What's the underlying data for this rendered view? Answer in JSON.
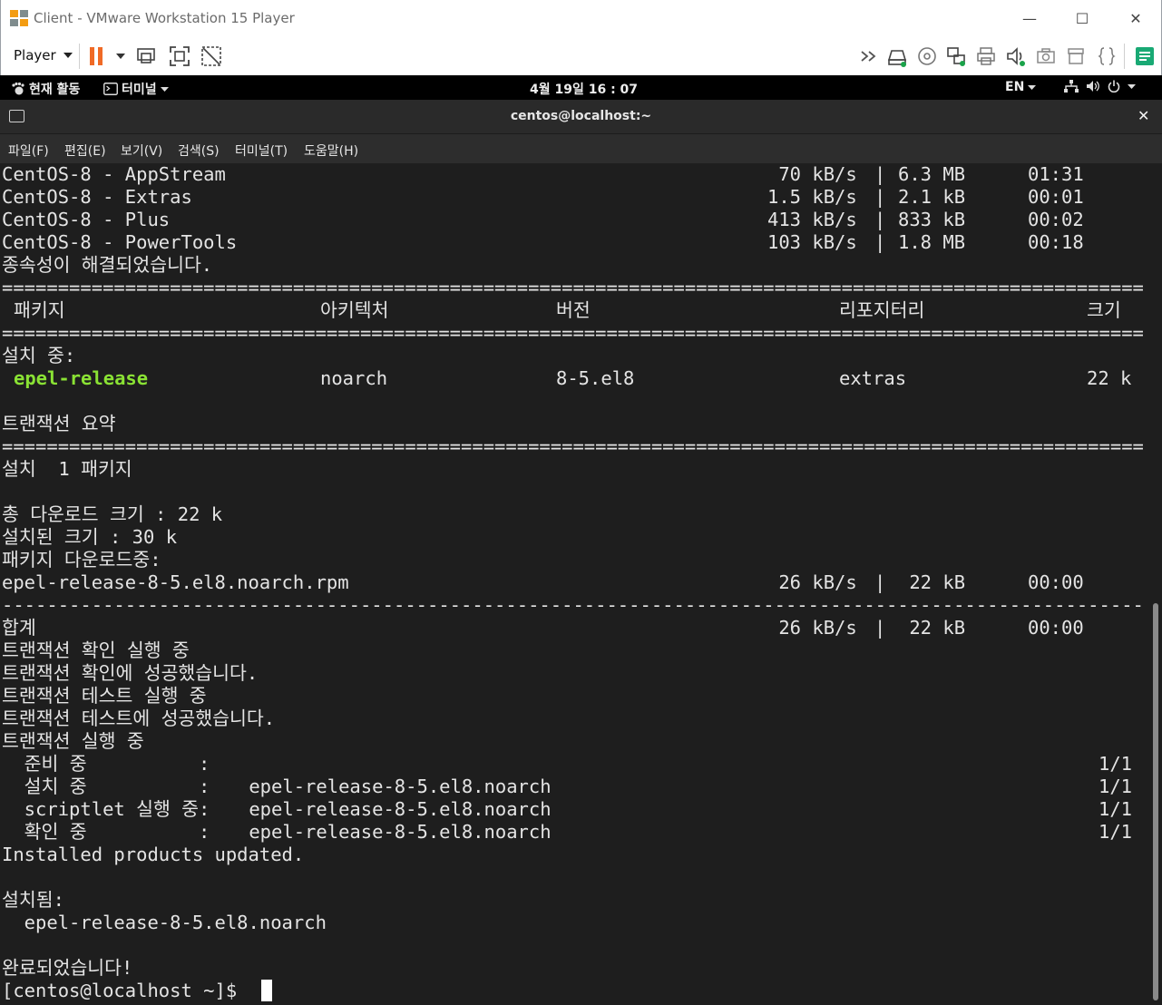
{
  "window": {
    "title": "Client - VMware Workstation 15 Player",
    "minimize": "—",
    "maximize": "☐",
    "close": "✕"
  },
  "toolbar": {
    "player_label": "Player",
    "icons": [
      "pause-icon",
      "dropdown-icon",
      "send-ctrl-alt-del-icon",
      "full-screen-icon",
      "unity-icon",
      "forward-icon",
      "hard-disk-icon",
      "cd-icon",
      "network-icon",
      "printer-icon",
      "sound-icon",
      "camera-icon",
      "usb-icon",
      "brackets-icon",
      "notes-icon"
    ]
  },
  "gnome": {
    "activities": "현재 활동",
    "app_menu": "터미널",
    "clock": "4월 19일  16 : 07",
    "input_method": "EN"
  },
  "terminal": {
    "title": "centos@localhost:~",
    "close": "✕",
    "menu": [
      "파일(F)",
      "편집(E)",
      "보기(V)",
      "검색(S)",
      "터미널(T)",
      "도움말(H)"
    ],
    "repos": [
      {
        "name": "CentOS-8 - AppStream",
        "speed": " 70 kB/s",
        "size": "6.3 MB",
        "time": "01:31"
      },
      {
        "name": "CentOS-8 - Extras",
        "speed": "1.5 kB/s",
        "size": "2.1 kB",
        "time": "00:01"
      },
      {
        "name": "CentOS-8 - Plus",
        "speed": "413 kB/s",
        "size": "833 kB",
        "time": "00:02"
      },
      {
        "name": "CentOS-8 - PowerTools",
        "speed": "103 kB/s",
        "size": "1.8 MB",
        "time": "00:18"
      }
    ],
    "deps_resolved": "종속성이 해결되었습니다.",
    "table_headers": {
      "package": "패키지",
      "arch": "아키텍처",
      "version": "버전",
      "repo": "리포지터리",
      "size": "크기"
    },
    "installing_label": "설치 중:",
    "package_row": {
      "name": "epel-release",
      "arch": "noarch",
      "version": "8-5.el8",
      "repo": "extras",
      "size": "22 k"
    },
    "transaction_summary": "트랜잭션 요약",
    "install_count": "설치  1 패키지",
    "total_download": "총 다운로드 크기 : 22 k",
    "installed_size": "설치된 크기 : 30 k",
    "downloading": "패키지 다운로드중:",
    "rpm_line": {
      "name": "epel-release-8-5.el8.noarch.rpm",
      "speed": " 26 kB/s",
      "size": " 22 kB",
      "time": "00:00"
    },
    "total_line": {
      "name": "합계",
      "speed": " 26 kB/s",
      "size": " 22 kB",
      "time": "00:00"
    },
    "steps": [
      "트랜잭션 확인 실행 중",
      "트랜잭션 확인에 성공했습니다.",
      "트랜잭션 테스트 실행 중",
      "트랜잭션 테스트에 성공했습니다.",
      "트랜잭션 실행 중"
    ],
    "progress": [
      {
        "label": "  준비 중          :",
        "pkg": "",
        "count": "1/1"
      },
      {
        "label": "  설치 중          :",
        "pkg": " epel-release-8-5.el8.noarch",
        "count": "1/1"
      },
      {
        "label": "  scriptlet 실행 중:",
        "pkg": " epel-release-8-5.el8.noarch",
        "count": "1/1"
      },
      {
        "label": "  확인 중          :",
        "pkg": " epel-release-8-5.el8.noarch",
        "count": "1/1"
      }
    ],
    "products_updated": "Installed products updated.",
    "installed_label": "설치됨:",
    "installed_pkg": "  epel-release-8-5.el8.noarch",
    "done": "완료되었습니다!",
    "prompt": "[centos@localhost ~]$ "
  }
}
